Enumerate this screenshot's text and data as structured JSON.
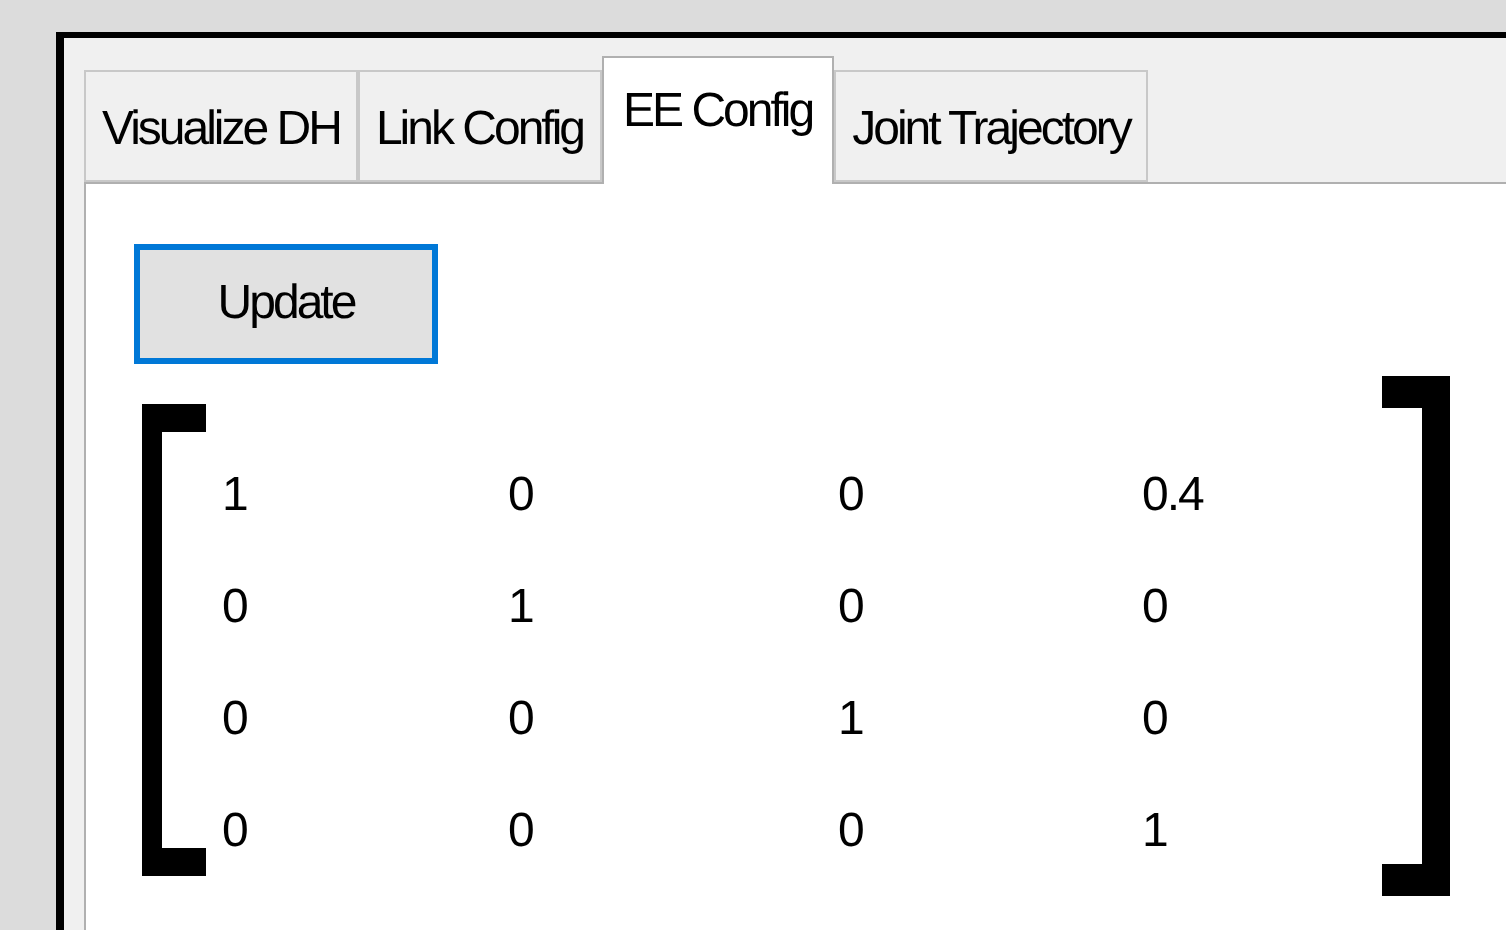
{
  "tabs": [
    {
      "label": "Visualize DH",
      "selected": false
    },
    {
      "label": "Link Config",
      "selected": false
    },
    {
      "label": "EE Config",
      "selected": true
    },
    {
      "label": "Joint Trajectory",
      "selected": false
    }
  ],
  "update_button": "Update",
  "matrix": [
    [
      "1",
      "0",
      "0",
      "0.4"
    ],
    [
      "0",
      "1",
      "0",
      "0"
    ],
    [
      "0",
      "0",
      "1",
      "0"
    ],
    [
      "0",
      "0",
      "0",
      "1"
    ]
  ]
}
